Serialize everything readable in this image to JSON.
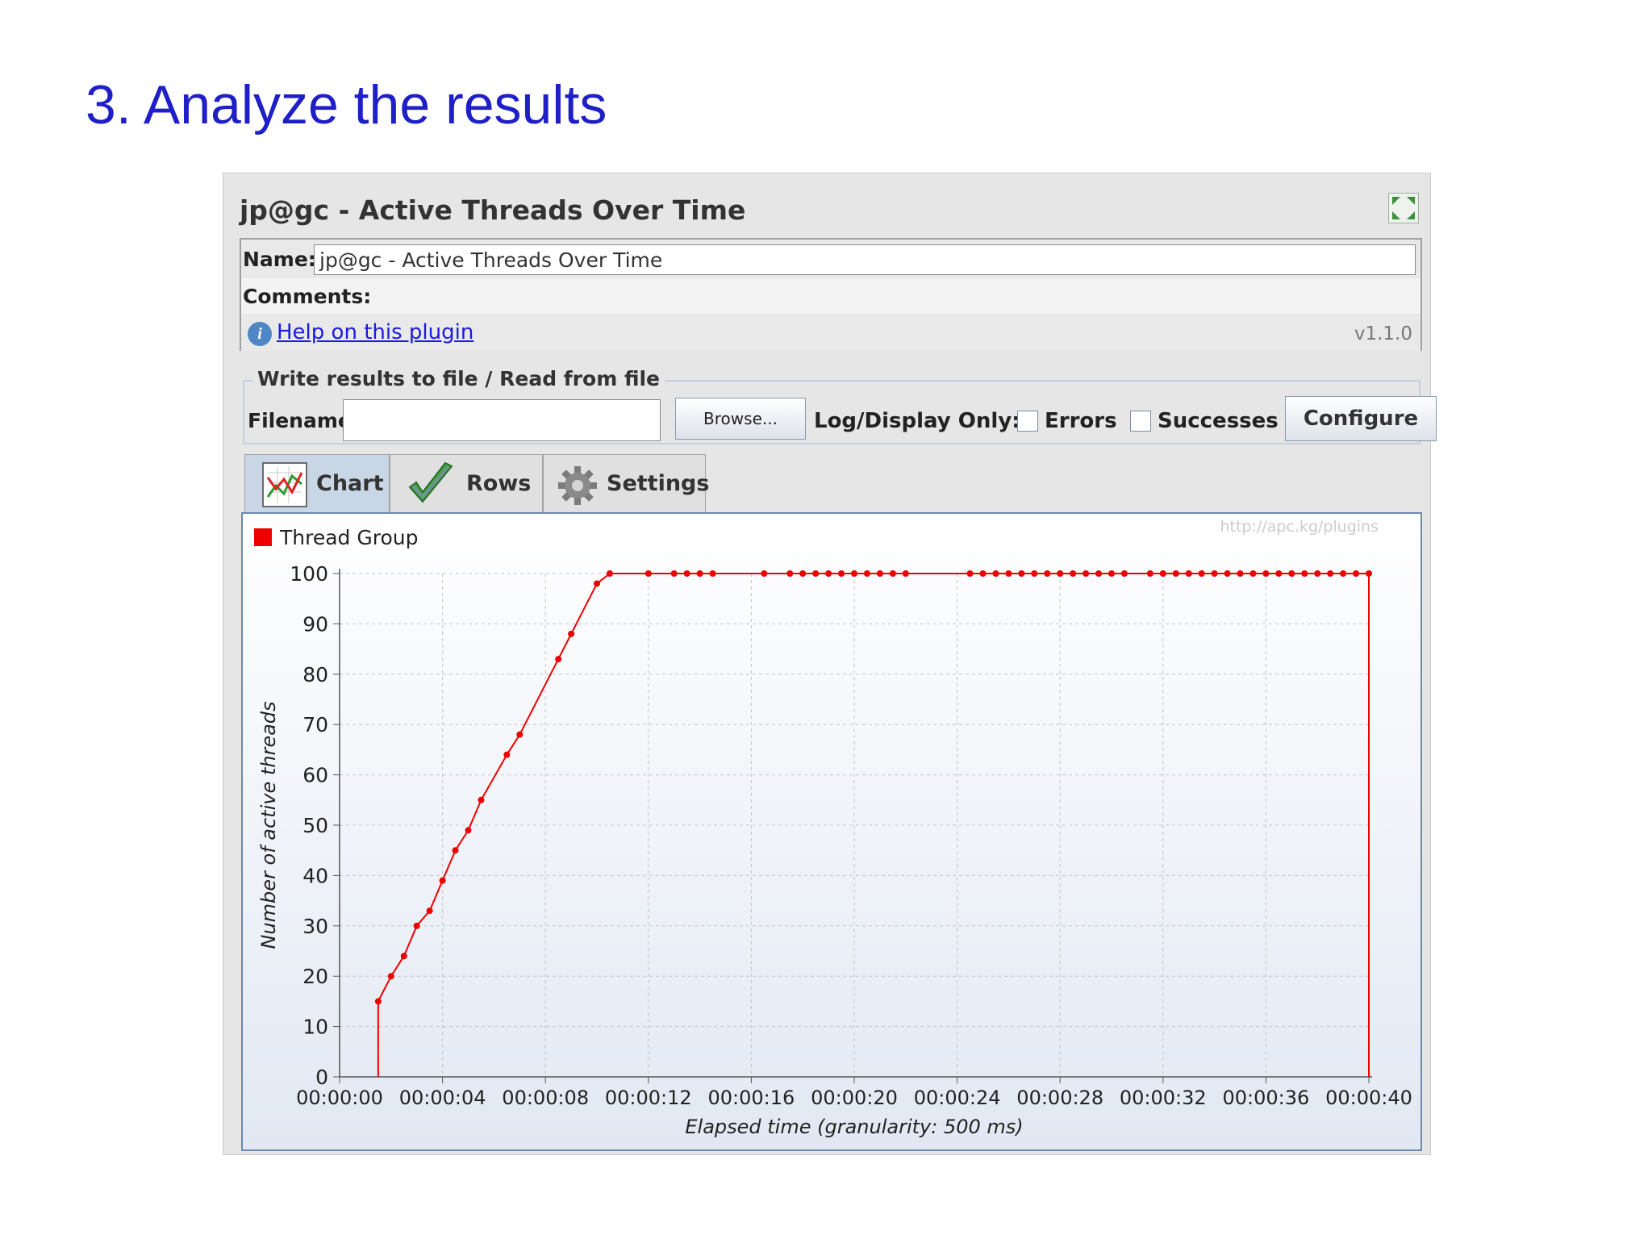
{
  "slide": {
    "title": "3. Analyze the results"
  },
  "panel": {
    "title": "jp@gc - Active Threads Over Time",
    "name_label": "Name:",
    "name_value": "jp@gc - Active Threads Over Time",
    "comments_label": "Comments:",
    "help_link": "Help on this plugin",
    "version": "v1.1.0"
  },
  "file_section": {
    "legend": "Write results to file / Read from file",
    "filename_label": "Filename",
    "filename_value": "",
    "browse_label": "Browse...",
    "log_display_label": "Log/Display Only:",
    "errors_label": "Errors",
    "successes_label": "Successes",
    "configure_label": "Configure"
  },
  "tabs": [
    {
      "label": "Chart",
      "icon": "chart-icon",
      "active": true
    },
    {
      "label": "Rows",
      "icon": "checkmark-icon",
      "active": false
    },
    {
      "label": "Settings",
      "icon": "gear-icon",
      "active": false
    }
  ],
  "chart_watermark": "http://apc.kg/plugins",
  "chart_data": {
    "type": "line",
    "title": "",
    "xlabel": "Elapsed time (granularity: 500 ms)",
    "ylabel": "Number of active threads",
    "x_unit": "seconds",
    "xlim": [
      0,
      40
    ],
    "ylim": [
      0,
      100
    ],
    "x_ticks": [
      "00:00:00",
      "00:00:04",
      "00:00:08",
      "00:00:12",
      "00:00:16",
      "00:00:20",
      "00:00:24",
      "00:00:28",
      "00:00:32",
      "00:00:36",
      "00:00:40"
    ],
    "y_ticks": [
      0,
      10,
      20,
      30,
      40,
      50,
      60,
      70,
      80,
      90,
      100
    ],
    "grid": true,
    "legend_position": "top-left",
    "series": [
      {
        "name": "Thread Group",
        "color": "#ee0000",
        "x": [
          1.5,
          2.0,
          2.5,
          3.0,
          3.5,
          4.0,
          4.5,
          5.0,
          5.5,
          6.5,
          7.0,
          8.5,
          9.0,
          10.0,
          10.5,
          12.0,
          13.0,
          13.5,
          14.0,
          14.5,
          16.5,
          17.5,
          18.0,
          18.5,
          19.0,
          19.5,
          20.0,
          20.5,
          21.0,
          21.5,
          22.0,
          24.5,
          25.0,
          25.5,
          26.0,
          26.5,
          27.0,
          27.5,
          28.0,
          28.5,
          29.0,
          29.5,
          30.0,
          30.5,
          31.5,
          32.0,
          32.5,
          33.0,
          33.5,
          34.0,
          34.5,
          35.0,
          35.5,
          36.0,
          36.5,
          37.0,
          37.5,
          38.0,
          38.5,
          39.0,
          39.5,
          40.0
        ],
        "y": [
          15,
          20,
          24,
          30,
          33,
          39,
          45,
          49,
          55,
          64,
          68,
          83,
          88,
          98,
          100,
          100,
          100,
          100,
          100,
          100,
          100,
          100,
          100,
          100,
          100,
          100,
          100,
          100,
          100,
          100,
          100,
          100,
          100,
          100,
          100,
          100,
          100,
          100,
          100,
          100,
          100,
          100,
          100,
          100,
          100,
          100,
          100,
          100,
          100,
          100,
          100,
          100,
          100,
          100,
          100,
          100,
          100,
          100,
          100,
          100,
          100,
          100
        ]
      }
    ]
  }
}
